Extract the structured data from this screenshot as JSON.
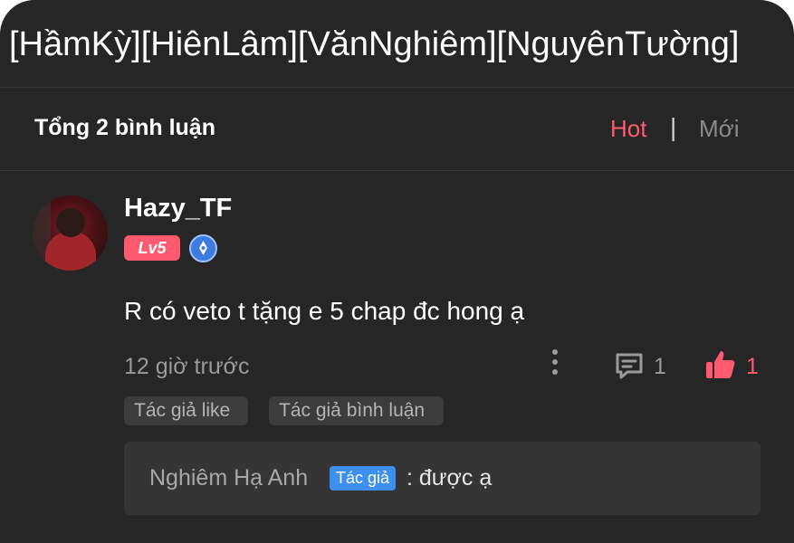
{
  "header": {
    "title": "[HầmKỳ][HiênLâm][VănNghiêm][NguyênTường]"
  },
  "comments_header": {
    "total_label": "Tổng 2 bình luận",
    "tabs": [
      {
        "label": "Hot",
        "active": true
      },
      {
        "label": "Mới",
        "active": false
      }
    ],
    "separator": "|"
  },
  "comment": {
    "username": "Hazy_TF",
    "level": "Lv5",
    "text": "R có veto t tặng e 5 chap đc hong ạ",
    "time": "12 giờ trước",
    "reply_count": "1",
    "like_count": "1",
    "tags": [
      "Tác giả like",
      "Tác giả bình luận"
    ],
    "reply": {
      "author": "Nghiêm Hạ Anh",
      "author_badge": "Tác giả",
      "text": ": được ạ"
    }
  },
  "colors": {
    "background": "#262626",
    "accent": "#ff5a6e",
    "author_badge": "#3d8ff0"
  },
  "icons": [
    "pen-badge-icon",
    "more-vertical-icon",
    "reply-icon",
    "thumbs-up-icon"
  ]
}
